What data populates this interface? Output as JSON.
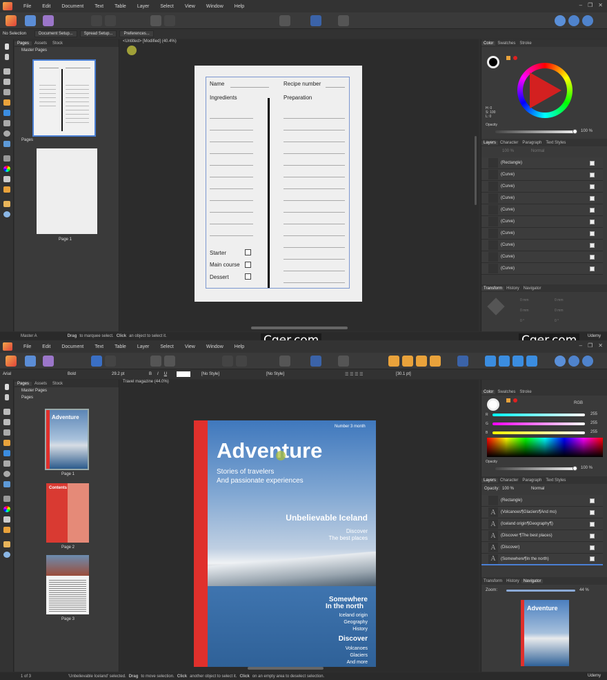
{
  "menu": [
    "File",
    "Edit",
    "Document",
    "Text",
    "Table",
    "Layer",
    "Select",
    "View",
    "Window",
    "Help"
  ],
  "top": {
    "context": {
      "selection": "No Selection",
      "buttons": [
        "Document Setup...",
        "Spread Setup...",
        "Preferences..."
      ]
    },
    "pages_tabs": [
      "Pages",
      "Assets",
      "Stock"
    ],
    "master_pages_label": "Master Pages",
    "pages_label": "Pages",
    "page1_label": "Page 1",
    "doc_tab": "<Untitled> [Modified] (40.4%)",
    "recipe": {
      "name": "Name",
      "recipe_number": "Recipe number",
      "ingredients": "Ingredients",
      "preparation": "Preparation",
      "starter": "Starter",
      "main_course": "Main course",
      "dessert": "Dessert"
    },
    "color_tabs": [
      "Color",
      "Swatches",
      "Stroke"
    ],
    "hsl": {
      "h": "H: 0",
      "s": "S: 100",
      "l": "L: 0"
    },
    "opacity_label": "Opacity",
    "opacity_value": "100 %",
    "layers_tabs": [
      "Layers",
      "Character",
      "Paragraph",
      "Text Styles"
    ],
    "layers_opacity": "100 %",
    "layers_blend": "Normal",
    "layers": [
      "(Rectangle)",
      "(Curve)",
      "(Curve)",
      "(Curve)",
      "(Curve)",
      "(Curve)",
      "(Curve)",
      "(Curve)",
      "(Curve)",
      "(Curve)"
    ],
    "transform_tabs": [
      "Transform",
      "History",
      "Navigator"
    ],
    "transform_values": [
      "0 mm",
      "0 mm",
      "0 mm",
      "0 mm",
      "0 °",
      "0 °"
    ],
    "status": {
      "master": "Master A",
      "hint_1": "Drag",
      "hint_2": "to marquee select.",
      "hint_3": "Click",
      "hint_4": "an object to select it."
    }
  },
  "bottom": {
    "context": {
      "font": "Arial",
      "weight": "Bold",
      "size": "29.2 pt",
      "style1": "[No Style]",
      "style2": "[No Style]",
      "leading": "[30.1 pt]",
      "b": "B",
      "i": "I",
      "u": "U"
    },
    "pages_tabs": [
      "Pages",
      "Assets",
      "Stock"
    ],
    "master_pages_label": "Master Pages",
    "pages_label": "Pages",
    "page_labels": [
      "Page 1",
      "Page 2",
      "Page 3"
    ],
    "contents_label": "Contents",
    "doc_tab": "Travel magazine (44.0%)",
    "magazine": {
      "issue": "Number 3 month",
      "title": "Adventure",
      "subtitle_1": "Stories of travelers",
      "subtitle_2": "And passionate experiences",
      "h1": "Unbelievable Iceland",
      "h1_l1": "Discover",
      "h1_l2": "The best places",
      "h2_l1": "Somewhere",
      "h2_l2": "In the north",
      "h2_i1": "Iceland origin",
      "h2_i2": "Geography",
      "h2_i3": "History",
      "h3": "Discover",
      "h3_i1": "Volcanoes",
      "h3_i2": "Glaciers",
      "h3_i3": "And more"
    },
    "color_tabs": [
      "Color",
      "Swatches",
      "Stroke"
    ],
    "color_model": "RGB",
    "rgb": [
      {
        "label": "R",
        "value": "255"
      },
      {
        "label": "G",
        "value": "255"
      },
      {
        "label": "B",
        "value": "255"
      }
    ],
    "opacity_label": "Opacity",
    "opacity_value": "100 %",
    "layers_tabs": [
      "Layers",
      "Character",
      "Paragraph",
      "Text Styles"
    ],
    "layers_opacity_label": "Opacity:",
    "layers_opacity": "100 %",
    "layers_blend": "Normal",
    "layers": [
      "(Rectangle)",
      "(Volcanoes¶Glaciers¶And mo)",
      "(Iceland origin¶Geography¶)",
      "(Discover ¶The best places)",
      "(Discover)",
      "(Somewhere¶In the north)"
    ],
    "nav_tabs": [
      "Transform",
      "History",
      "Navigator"
    ],
    "zoom_label": "Zoom:",
    "zoom_value": "44 %",
    "status": {
      "pages": "1 of 3",
      "hint": "'Unbelievable Iceland' selected.",
      "h2": "Drag",
      "h3": "to move selection.",
      "h4": "Click",
      "h5": "another object to select it.",
      "h6": "Click",
      "h7": "on an empty area to deselect selection."
    }
  },
  "watermark": "Cger.com",
  "udemy": "Udemy",
  "colors": {
    "accent_blue": "#4a7fd4",
    "magazine_red": "#e0302c",
    "panel": "#3a3a3a"
  }
}
